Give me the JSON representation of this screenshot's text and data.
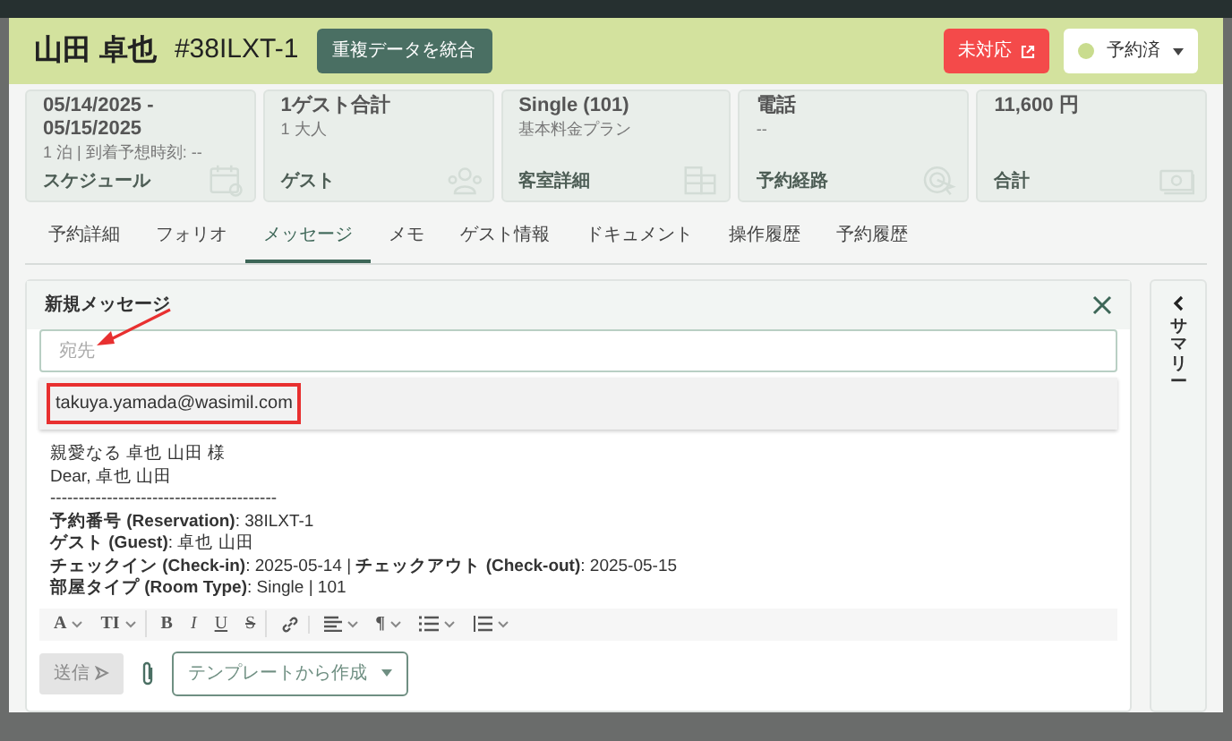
{
  "header": {
    "name": "山田 卓也",
    "code": "#38ILXT-1",
    "merge_button": "重複データを統合",
    "alert_button": "未対応",
    "status_select": {
      "value": "予約済",
      "color": "#c9dc8e"
    }
  },
  "summary_cards": [
    {
      "kind": "calendar",
      "lines": [
        "05/14/2025 -",
        "05/15/2025"
      ],
      "sub": "1 泊 | 到着予想時刻: --",
      "label": "スケジュール"
    },
    {
      "kind": "people",
      "lines": [
        "1ゲスト合計"
      ],
      "sub": "1 大人",
      "label": "ゲスト"
    },
    {
      "kind": "building",
      "lines": [
        "Single (101)"
      ],
      "sub": "基本料金プラン",
      "label": "客室詳細"
    },
    {
      "kind": "cursor",
      "lines": [
        "電話"
      ],
      "sub": "--",
      "label": "予約経路"
    },
    {
      "kind": "money",
      "lines": [
        "11,600 円"
      ],
      "label": "合計"
    }
  ],
  "tabs": [
    {
      "label": "予約詳細",
      "selected": false
    },
    {
      "label": "フォリオ",
      "selected": false
    },
    {
      "label": "メッセージ",
      "selected": true
    },
    {
      "label": "メモ",
      "selected": false
    },
    {
      "label": "ゲスト情報",
      "selected": false
    },
    {
      "label": "ドキュメント",
      "selected": false
    },
    {
      "label": "操作履歴",
      "selected": false
    },
    {
      "label": "予約履歴",
      "selected": false
    }
  ],
  "composer": {
    "title": "新規メッセージ",
    "to_placeholder": "宛先",
    "suggestion": {
      "email": "takuya.yamada@wasimil.com",
      "highlighted": true
    },
    "body": [
      "親愛なる 卓也 山田 様",
      "Dear, 卓也 山田",
      "----------------------------------------",
      "**予約番号 (Reservation)**: 38ILXT-1",
      "**ゲスト (Guest)**: 卓也 山田",
      "**チェックイン (Check-in)**: 2025-05-14 | **チェックアウト (Check-out)**: 2025-05-15",
      "**部屋タイプ (Room Type)**: Single | 101"
    ],
    "toolbar": [
      {
        "kind": "text",
        "label": "A",
        "caret": true,
        "group_end": false
      },
      {
        "kind": "text",
        "label": "TI",
        "caret": true,
        "group_end": true
      },
      {
        "kind": "bold",
        "label": "B",
        "caret": false,
        "group_end": false
      },
      {
        "kind": "italic",
        "label": "I",
        "caret": false,
        "group_end": false
      },
      {
        "kind": "underline",
        "label": "U",
        "caret": false,
        "group_end": false
      },
      {
        "kind": "strike",
        "label": "S",
        "caret": false,
        "group_end": true
      },
      {
        "kind": "link",
        "caret": false,
        "group_end": true
      },
      {
        "kind": "align",
        "caret": true,
        "group_end": false
      },
      {
        "kind": "text",
        "label": "¶",
        "caret": true,
        "group_end": false
      },
      {
        "kind": "bullets",
        "caret": true,
        "group_end": false
      },
      {
        "kind": "numbers",
        "caret": true,
        "group_end": false
      }
    ],
    "send_button": {
      "label": "送信",
      "disabled": true
    },
    "template_button": "テンプレートから作成"
  },
  "side_panel": {
    "label": "サマリー"
  }
}
